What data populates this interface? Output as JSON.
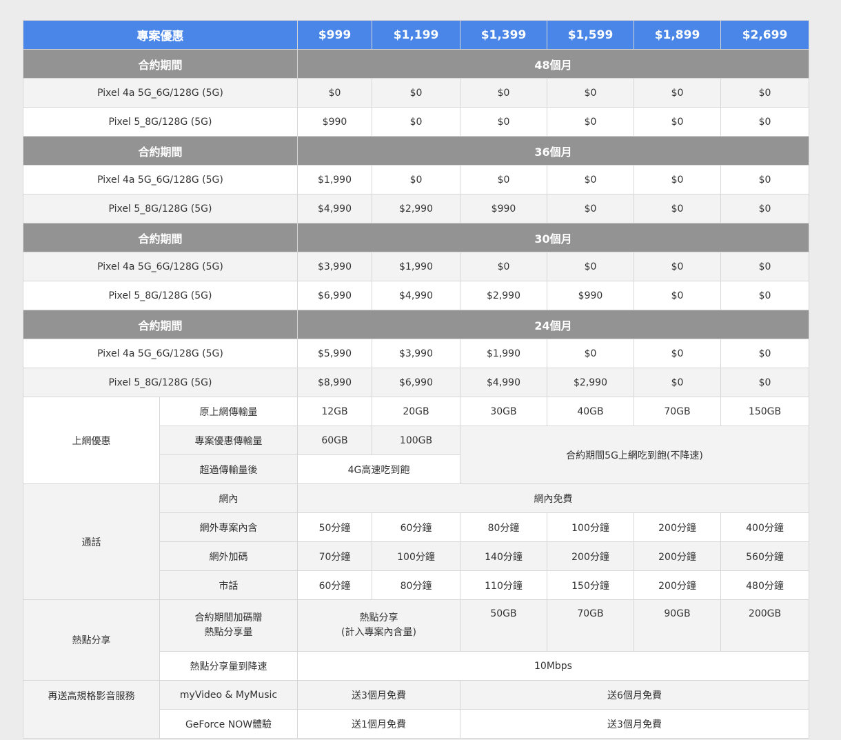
{
  "header": [
    "專案優惠",
    "$999",
    "$1,199",
    "$1,399",
    "$1,599",
    "$1,899",
    "$2,699"
  ],
  "period_label": "合約期間",
  "periods": [
    {
      "months": "48個月",
      "rows": [
        {
          "device": "Pixel 4a 5G_6G/128G (5G)",
          "prices": [
            "$0",
            "$0",
            "$0",
            "$0",
            "$0",
            "$0"
          ]
        },
        {
          "device": "Pixel 5_8G/128G (5G)",
          "prices": [
            "$990",
            "$0",
            "$0",
            "$0",
            "$0",
            "$0"
          ]
        }
      ]
    },
    {
      "months": "36個月",
      "rows": [
        {
          "device": "Pixel 4a 5G_6G/128G (5G)",
          "prices": [
            "$1,990",
            "$0",
            "$0",
            "$0",
            "$0",
            "$0"
          ]
        },
        {
          "device": "Pixel 5_8G/128G (5G)",
          "prices": [
            "$4,990",
            "$2,990",
            "$990",
            "$0",
            "$0",
            "$0"
          ]
        }
      ]
    },
    {
      "months": "30個月",
      "rows": [
        {
          "device": "Pixel 4a 5G_6G/128G (5G)",
          "prices": [
            "$3,990",
            "$1,990",
            "$0",
            "$0",
            "$0",
            "$0"
          ]
        },
        {
          "device": "Pixel 5_8G/128G (5G)",
          "prices": [
            "$6,990",
            "$4,990",
            "$2,990",
            "$990",
            "$0",
            "$0"
          ]
        }
      ]
    },
    {
      "months": "24個月",
      "rows": [
        {
          "device": "Pixel 4a 5G_6G/128G (5G)",
          "prices": [
            "$5,990",
            "$3,990",
            "$1,990",
            "$0",
            "$0",
            "$0"
          ]
        },
        {
          "device": "Pixel 5_8G/128G (5G)",
          "prices": [
            "$8,990",
            "$6,990",
            "$4,990",
            "$2,990",
            "$0",
            "$0"
          ]
        }
      ]
    }
  ],
  "internet": {
    "label": "上網優惠",
    "original_label": "原上網傳輸量",
    "original": [
      "12GB",
      "20GB",
      "30GB",
      "40GB",
      "70GB",
      "150GB"
    ],
    "plan_label": "專案優惠傳輸量",
    "plan": [
      "60GB",
      "100GB"
    ],
    "unlimited": "合約期間5G上網吃到飽(不降速)",
    "after_label": "超過傳輸量後",
    "after": "4G高速吃到飽"
  },
  "calls": {
    "label": "通話",
    "on_net_label": "網內",
    "on_net": "網內免費",
    "off_net_label": "網外專案內含",
    "off_net": [
      "50分鐘",
      "60分鐘",
      "80分鐘",
      "100分鐘",
      "200分鐘",
      "400分鐘"
    ],
    "bonus_label": "網外加碼",
    "bonus": [
      "70分鐘",
      "100分鐘",
      "140分鐘",
      "200分鐘",
      "200分鐘",
      "560分鐘"
    ],
    "landline_label": "市話",
    "landline": [
      "60分鐘",
      "80分鐘",
      "110分鐘",
      "150分鐘",
      "200分鐘",
      "480分鐘"
    ]
  },
  "hotspot": {
    "label": "熱點分享",
    "extra_label_1": "合約期間加碼贈",
    "extra_label_2": "熱點分享量",
    "extra_first_1": "熱點分享",
    "extra_first_2": "(計入專案內含量)",
    "extra": [
      "50GB",
      "70GB",
      "90GB",
      "200GB"
    ],
    "speed_label": "熱點分享量到降速",
    "speed": "10Mbps"
  },
  "media": {
    "label": "再送高規格影音服務",
    "myvideo_label": "myVideo & MyMusic",
    "myvideo_low": "送3個月免費",
    "myvideo_high": "送6個月免費",
    "geforce_label": "GeForce NOW體驗",
    "geforce_low": "送1個月免費",
    "geforce_high": "送3個月免費"
  }
}
